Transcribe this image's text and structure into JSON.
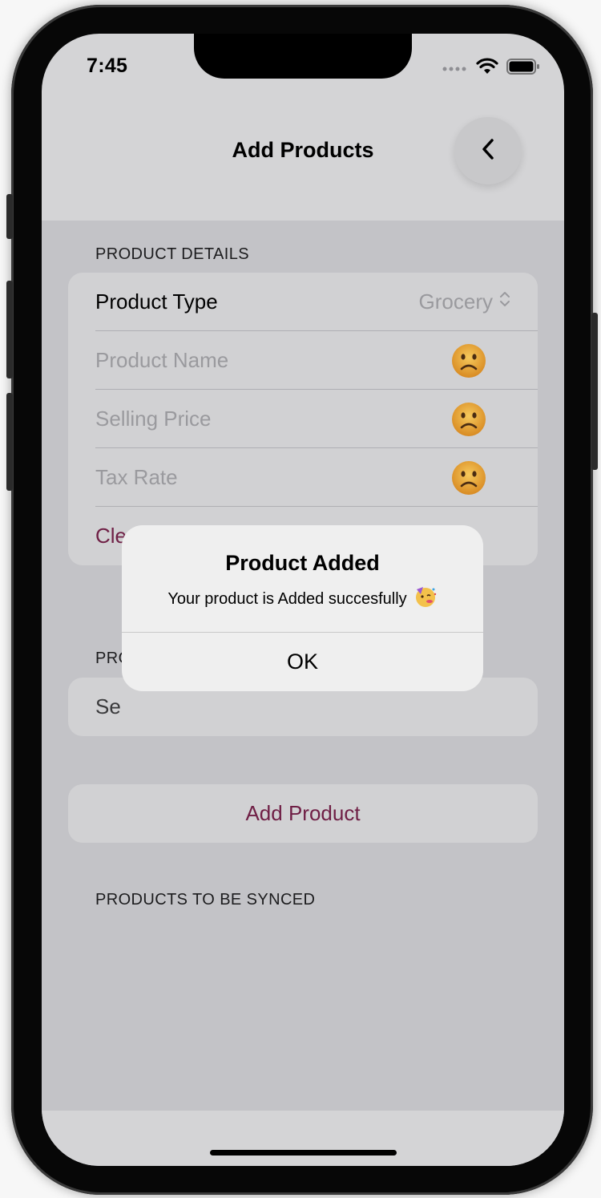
{
  "status_bar": {
    "time": "7:45"
  },
  "nav": {
    "title": "Add Products"
  },
  "sections": {
    "product_details": "PRODUCT DETAILS",
    "second_header_partial": "PRO",
    "products_to_sync": "PRODUCTS TO BE SYNCED"
  },
  "product_type": {
    "label": "Product Type",
    "value": "Grocery"
  },
  "fields": {
    "product_name_placeholder": "Product Name",
    "selling_price_placeholder": "Selling Price",
    "tax_rate_placeholder": "Tax Rate"
  },
  "clear_partial": "Cle",
  "second_card_partial": "Se",
  "add_button_label": "Add Product",
  "alert": {
    "title": "Product Added",
    "message": "Your product is Added succesfully",
    "ok_label": "OK"
  },
  "icons": {
    "invalid_indicator": "frowning-face-icon",
    "party": "partying-face-icon"
  },
  "colors": {
    "accent": "#6f1f45"
  }
}
